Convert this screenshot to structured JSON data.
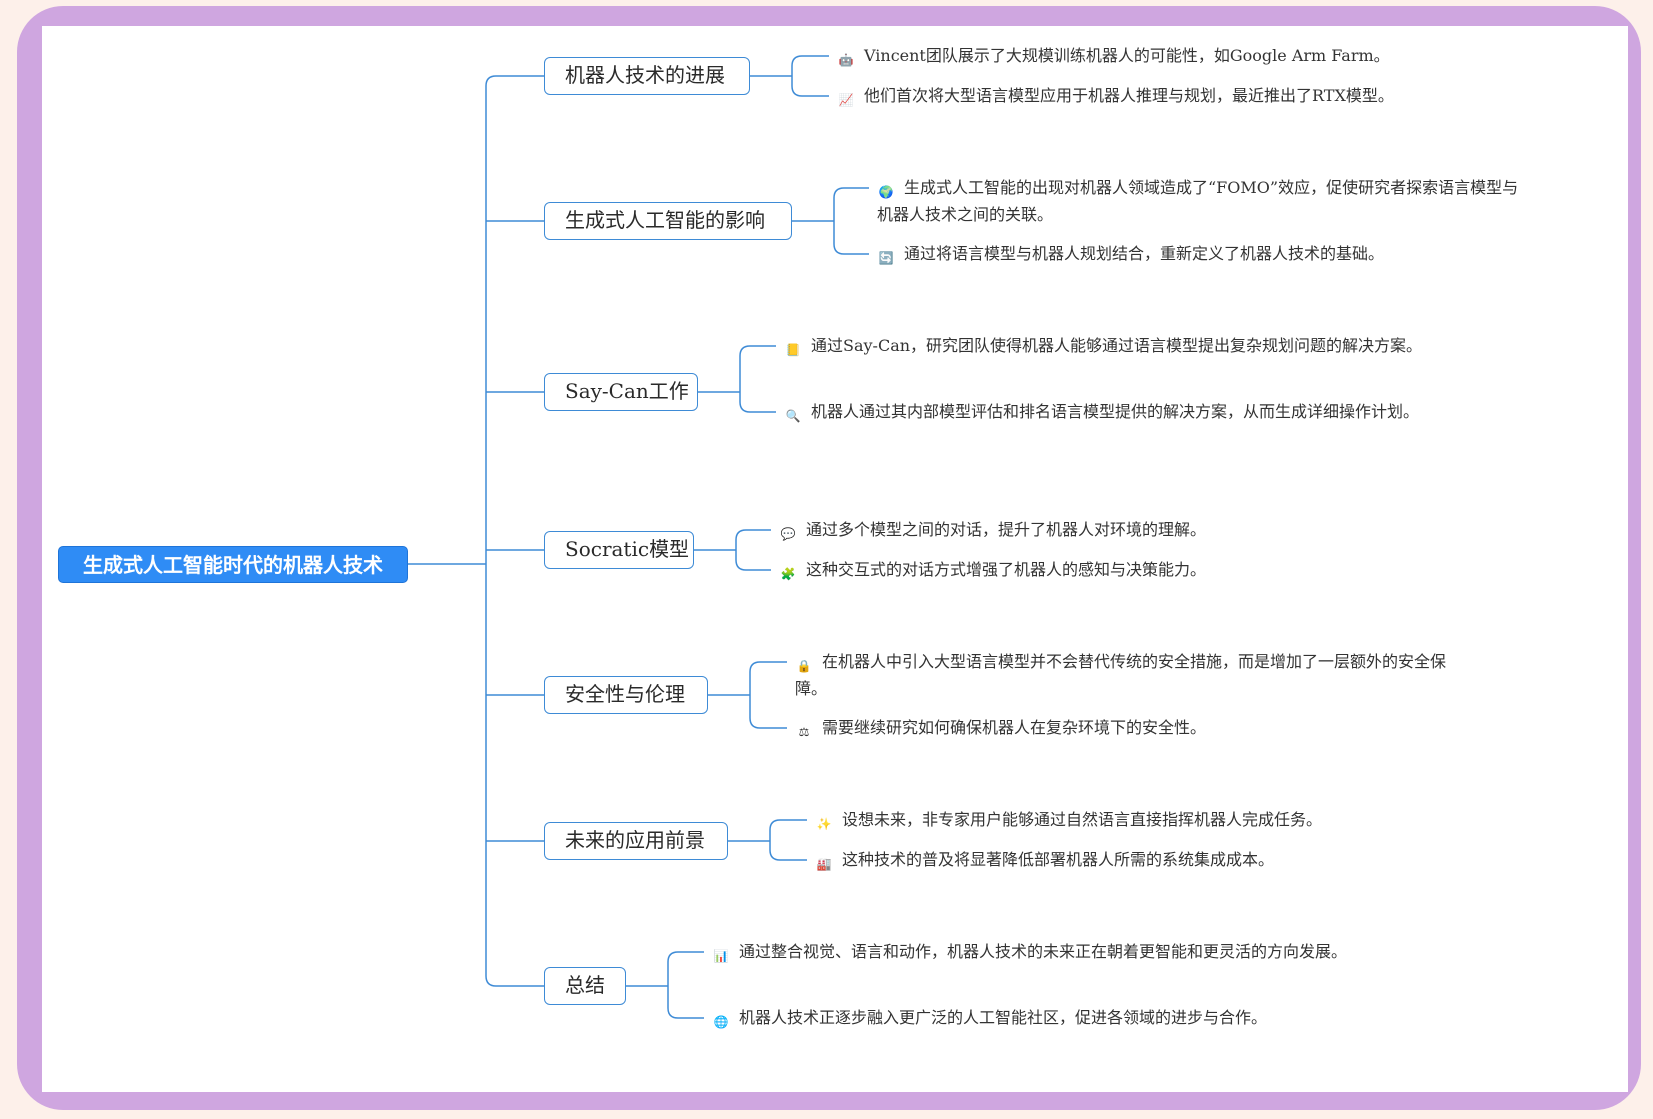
{
  "root": {
    "label": "生成式人工智能时代的机器人技术"
  },
  "branches": [
    {
      "label": "机器人技术的进展",
      "items": [
        {
          "icon": "robot-icon",
          "text": "Vincent团队展示了大规模训练机器人的可能性，如Google Arm Farm。"
        },
        {
          "icon": "chart-up-icon",
          "text": "他们首次将大型语言模型应用于机器人推理与规划，最近推出了RTX模型。"
        }
      ]
    },
    {
      "label": "生成式人工智能的影响",
      "items": [
        {
          "icon": "globe-icon",
          "text": "生成式人工智能的出现对机器人领域造成了“FOMO”效应，促使研究者探索语言模型与机器人技术之间的关联。"
        },
        {
          "icon": "refresh-icon",
          "text": "通过将语言模型与机器人规划结合，重新定义了机器人技术的基础。"
        }
      ]
    },
    {
      "label": "Say-Can工作",
      "items": [
        {
          "icon": "notebook-icon",
          "text": "通过Say-Can，研究团队使得机器人能够通过语言模型提出复杂规划问题的解决方案。"
        },
        {
          "icon": "magnifier-icon",
          "text": "机器人通过其内部模型评估和排名语言模型提供的解决方案，从而生成详细操作计划。"
        }
      ]
    },
    {
      "label": "Socratic模型",
      "items": [
        {
          "icon": "speech-bubble-icon",
          "text": "通过多个模型之间的对话，提升了机器人对环境的理解。"
        },
        {
          "icon": "puzzle-icon",
          "text": "这种交互式的对话方式增强了机器人的感知与决策能力。"
        }
      ]
    },
    {
      "label": "安全性与伦理",
      "items": [
        {
          "icon": "lock-icon",
          "text": "在机器人中引入大型语言模型并不会替代传统的安全措施，而是增加了一层额外的安全保障。"
        },
        {
          "icon": "scales-icon",
          "text": "需要继续研究如何确保机器人在复杂环境下的安全性。"
        }
      ]
    },
    {
      "label": "未来的应用前景",
      "items": [
        {
          "icon": "sparkle-icon",
          "text": "设想未来，非专家用户能够通过自然语言直接指挥机器人完成任务。"
        },
        {
          "icon": "factory-icon",
          "text": "这种技术的普及将显著降低部署机器人所需的系统集成成本。"
        }
      ]
    },
    {
      "label": "总结",
      "items": [
        {
          "icon": "bar-chart-icon",
          "text": "通过整合视觉、语言和动作，机器人技术的未来正在朝着更智能和更灵活的方向发展。"
        },
        {
          "icon": "network-globe-icon",
          "text": "机器人技术正逐步融入更广泛的人工智能社区，促进各领域的进步与合作。"
        }
      ]
    }
  ]
}
